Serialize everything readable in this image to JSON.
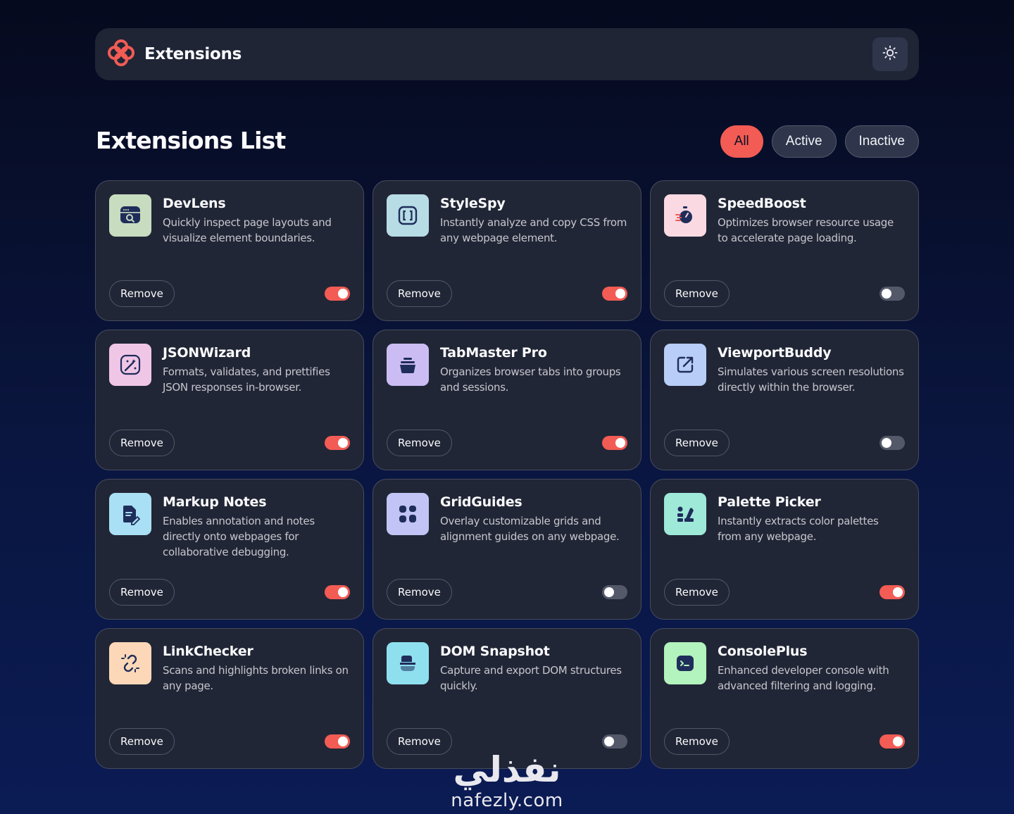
{
  "header": {
    "title": "Extensions",
    "logo_icon": "logo-flower-icon",
    "theme_icon": "sun-icon"
  },
  "main": {
    "title": "Extensions List",
    "filters": [
      {
        "label": "All",
        "active": true
      },
      {
        "label": "Active",
        "active": false
      },
      {
        "label": "Inactive",
        "active": false
      }
    ]
  },
  "colors": {
    "accent": "#f25c54",
    "card_bg": "#212636",
    "header_bg": "#1f2535"
  },
  "extensions": [
    {
      "name": "DevLens",
      "description": "Quickly inspect page layouts and visualize element boundaries.",
      "active": true,
      "remove_label": "Remove",
      "icon": "devlens-search-window-icon"
    },
    {
      "name": "StyleSpy",
      "description": "Instantly analyze and copy CSS from any webpage element.",
      "active": true,
      "remove_label": "Remove",
      "icon": "stylespy-brackets-icon"
    },
    {
      "name": "SpeedBoost",
      "description": "Optimizes browser resource usage to accelerate page loading.",
      "active": false,
      "remove_label": "Remove",
      "icon": "speedboost-stopwatch-icon"
    },
    {
      "name": "JSONWizard",
      "description": "Formats, validates, and prettifies JSON responses in-browser.",
      "active": true,
      "remove_label": "Remove",
      "icon": "jsonwizard-wand-icon"
    },
    {
      "name": "TabMaster Pro",
      "description": "Organizes browser tabs into groups and sessions.",
      "active": true,
      "remove_label": "Remove",
      "icon": "tabmaster-stack-icon"
    },
    {
      "name": "ViewportBuddy",
      "description": "Simulates various screen resolutions directly within the browser.",
      "active": false,
      "remove_label": "Remove",
      "icon": "viewportbuddy-resize-icon"
    },
    {
      "name": "Markup Notes",
      "description": "Enables annotation and notes directly onto webpages for collaborative debugging.",
      "active": true,
      "remove_label": "Remove",
      "icon": "markupnotes-note-icon"
    },
    {
      "name": "GridGuides",
      "description": "Overlay customizable grids and alignment guides on any webpage.",
      "active": false,
      "remove_label": "Remove",
      "icon": "gridguides-grid-icon"
    },
    {
      "name": "Palette Picker",
      "description": "Instantly extracts color palettes from any webpage.",
      "active": true,
      "remove_label": "Remove",
      "icon": "palettepicker-swatch-icon"
    },
    {
      "name": "LinkChecker",
      "description": "Scans and highlights broken links on any page.",
      "active": true,
      "remove_label": "Remove",
      "icon": "linkchecker-broken-link-icon"
    },
    {
      "name": "DOM Snapshot",
      "description": "Capture and export DOM structures quickly.",
      "active": false,
      "remove_label": "Remove",
      "icon": "domsnapshot-camera-icon"
    },
    {
      "name": "ConsolePlus",
      "description": "Enhanced developer console with advanced filtering and logging.",
      "active": true,
      "remove_label": "Remove",
      "icon": "consoleplus-terminal-icon"
    }
  ],
  "watermark": {
    "arabic": "نفذلي",
    "latin": "nafezly.com"
  }
}
